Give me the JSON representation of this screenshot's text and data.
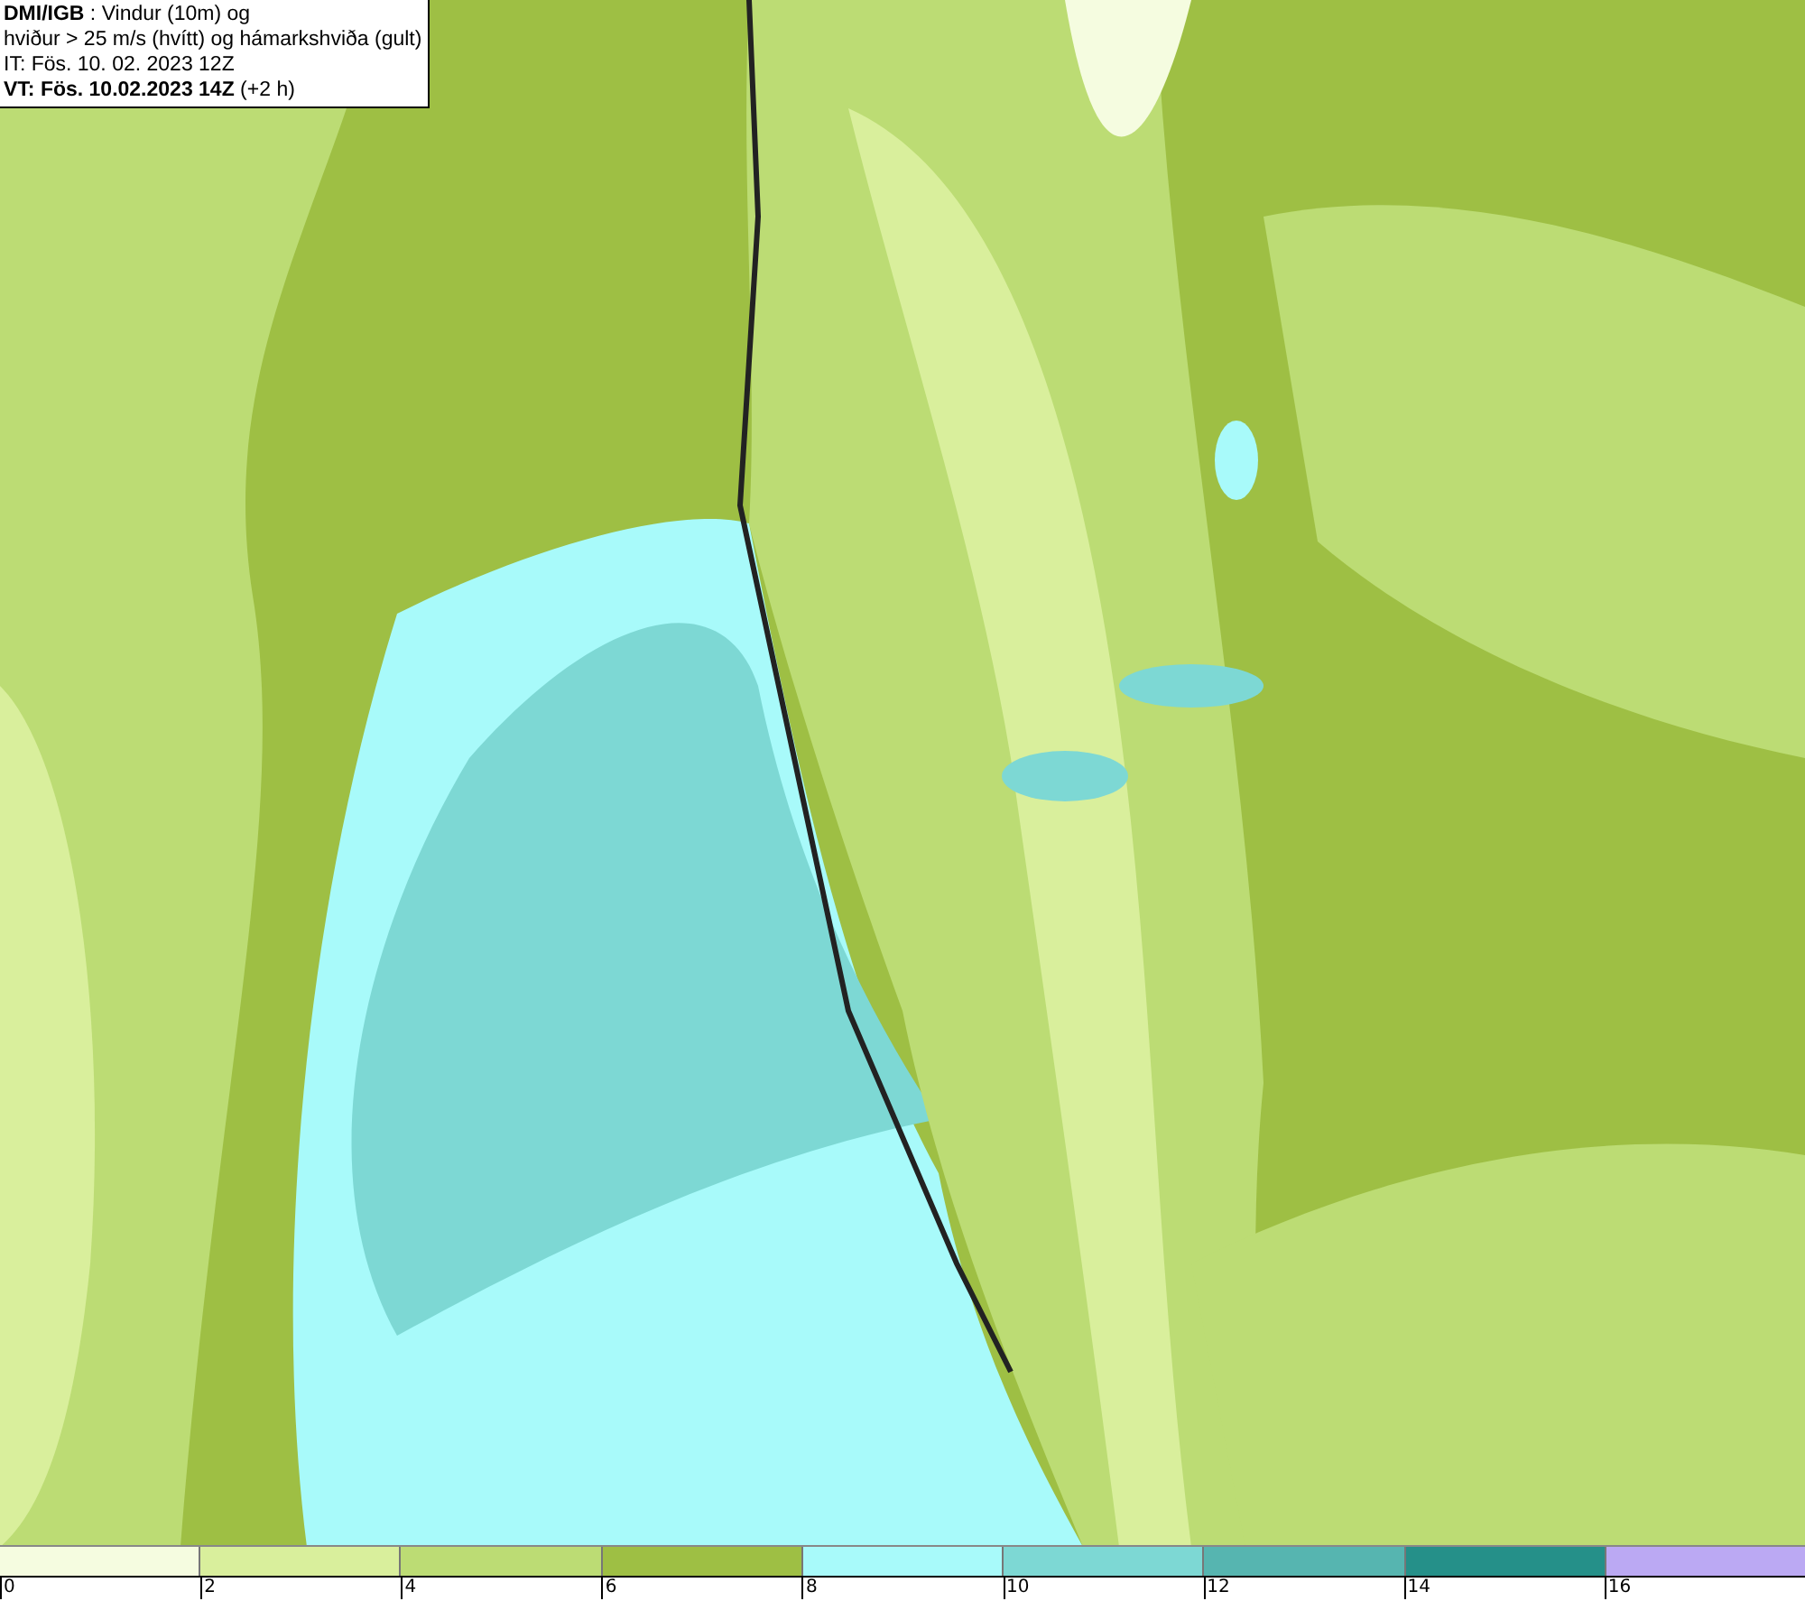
{
  "info_box": {
    "lines": [
      "**DMI/IGB** : Vindur (10m) og",
      "hviður > 25 m/s (hvítt) og hámarkshviða (gult)",
      "IT: Fös. 10. 02. 2023 12Z",
      "**VT: Fös. 10.02.2023 14Z** (+2 h)"
    ]
  },
  "legend": {
    "swatches": [
      {
        "color": "#f5fce0"
      },
      {
        "color": "#d9ef9c"
      },
      {
        "color": "#bcdc74"
      },
      {
        "color": "#9ebf44"
      },
      {
        "color": "#a8fafa"
      },
      {
        "color": "#7dd8d4"
      },
      {
        "color": "#56b5b0"
      },
      {
        "color": "#259089"
      },
      {
        "color": "#bba9f3"
      }
    ],
    "labels": [
      "0",
      "2",
      "4",
      "6",
      "8",
      "10",
      "12",
      "14",
      "16"
    ]
  }
}
